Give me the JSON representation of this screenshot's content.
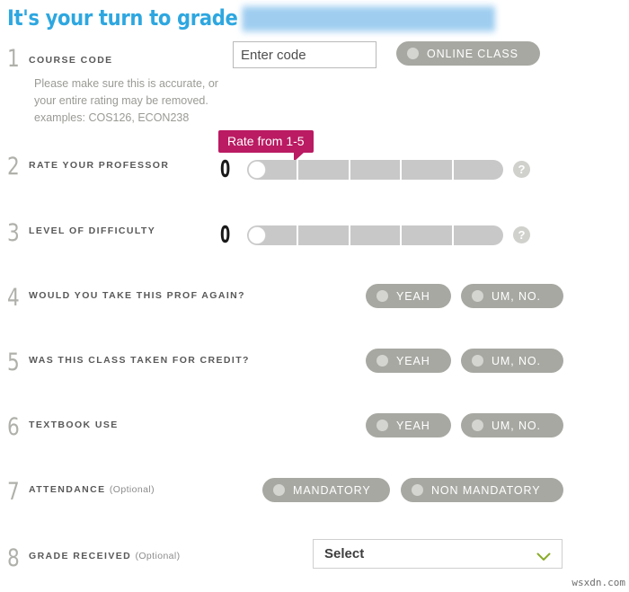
{
  "header": {
    "title_prefix": "It's your turn to grade",
    "professor_name_redacted": "Professor Name Hidden"
  },
  "course_code": {
    "number": "1",
    "label": "COURSE CODE",
    "help_text": "Please make sure this is accurate, or your entire rating may be removed. examples: COS126, ECON238",
    "input_placeholder": "Enter code",
    "input_value": "",
    "submit_icon": "enter-arrow-icon",
    "online_class_button": "ONLINE CLASS"
  },
  "rate_professor": {
    "number": "2",
    "label": "RATE YOUR PROFESSOR",
    "value": "0",
    "segments": 5,
    "tooltip": "Rate from 1-5",
    "help_icon": "?"
  },
  "difficulty": {
    "number": "3",
    "label": "LEVEL OF DIFFICULTY",
    "value": "0",
    "segments": 5,
    "help_icon": "?"
  },
  "take_again": {
    "number": "4",
    "label": "WOULD YOU TAKE THIS PROF AGAIN?",
    "option_yes": "YEAH",
    "option_no": "UM, NO."
  },
  "for_credit": {
    "number": "5",
    "label": "WAS THIS CLASS TAKEN FOR CREDIT?",
    "option_yes": "YEAH",
    "option_no": "UM, NO."
  },
  "textbook": {
    "number": "6",
    "label": "TEXTBOOK USE",
    "option_yes": "YEAH",
    "option_no": "UM, NO."
  },
  "attendance": {
    "number": "7",
    "label": "ATTENDANCE",
    "optional": "(Optional)",
    "option_mandatory": "MANDATORY",
    "option_non_mandatory": "NON MANDATORY"
  },
  "grade_received": {
    "number": "8",
    "label": "GRADE RECEIVED",
    "optional": "(Optional)",
    "select_value": "Select",
    "chevron_icon": "chevron-down-icon"
  },
  "watermark": "wsxdn.com",
  "colors": {
    "title_blue": "#2ea7e0",
    "tooltip_magenta": "#ba1b62",
    "pill_gray": "#a8a8a3",
    "chevron_green": "#8aab2a"
  }
}
